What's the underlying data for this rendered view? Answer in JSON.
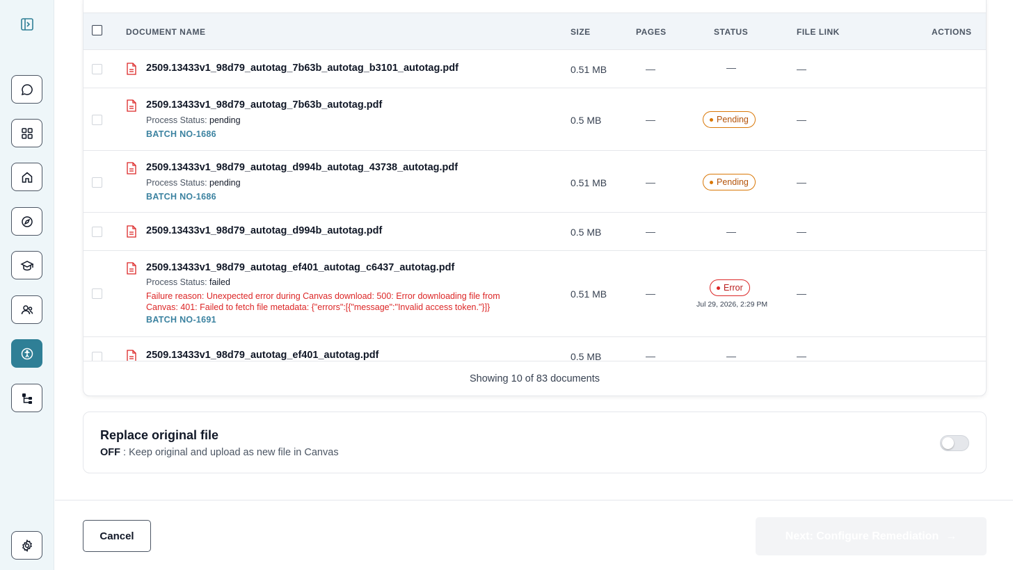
{
  "sidebar": {
    "items": [
      {
        "icon": "chat-bubble-icon"
      },
      {
        "icon": "grid-apps-icon"
      },
      {
        "icon": "home-icon"
      },
      {
        "icon": "compass-icon"
      },
      {
        "icon": "graduation-cap-icon"
      },
      {
        "icon": "users-icon"
      },
      {
        "icon": "accessibility-icon",
        "active": true
      },
      {
        "icon": "hierarchy-icon"
      }
    ],
    "settings_icon": "gear-icon",
    "accent_color": "#2f7f96"
  },
  "table": {
    "headers": {
      "document_name": "DOCUMENT NAME",
      "size": "SIZE",
      "pages": "PAGES",
      "status": "STATUS",
      "file_link": "FILE LINK",
      "actions": "ACTIONS"
    },
    "rows": [
      {
        "name": "2509.13433v1_98d79_autotag_7b63b_autotag_b3101_autotag.pdf",
        "size": "0.51 MB",
        "pages": "—",
        "status": "—",
        "file_link": "—"
      },
      {
        "name": "2509.13433v1_98d79_autotag_7b63b_autotag.pdf",
        "process_label": "Process Status:",
        "process_value": "pending",
        "batch": "BATCH NO-1686",
        "size": "0.5 MB",
        "pages": "—",
        "status": "Pending",
        "file_link": "—"
      },
      {
        "name": "2509.13433v1_98d79_autotag_d994b_autotag_43738_autotag.pdf",
        "process_label": "Process Status:",
        "process_value": "pending",
        "batch": "BATCH NO-1686",
        "size": "0.51 MB",
        "pages": "—",
        "status": "Pending",
        "file_link": "—"
      },
      {
        "name": "2509.13433v1_98d79_autotag_d994b_autotag.pdf",
        "size": "0.5 MB",
        "pages": "—",
        "status": "—",
        "file_link": "—"
      },
      {
        "name": "2509.13433v1_98d79_autotag_ef401_autotag_c6437_autotag.pdf",
        "process_label": "Process Status:",
        "process_value": "failed",
        "failure": "Failure reason: Unexpected error during Canvas download: 500: Error downloading file from Canvas: 401: Failed to fetch file metadata: {\"errors\":[{\"message\":\"Invalid access token.\"}]}",
        "batch": "BATCH NO-1691",
        "size": "0.51 MB",
        "pages": "—",
        "status": "Error",
        "status_time": "Jul 29, 2026, 2:29 PM",
        "file_link": "—"
      },
      {
        "name": "2509.13433v1_98d79_autotag_ef401_autotag.pdf",
        "size": "0.5 MB",
        "pages": "—",
        "status": "—",
        "file_link": "—"
      }
    ],
    "footer": "Showing 10 of 83 documents"
  },
  "replace": {
    "title": "Replace original file",
    "state": "OFF",
    "description": " : Keep original and upload as new file in Canvas",
    "enabled": false
  },
  "actions": {
    "cancel": "Cancel",
    "next": "Next: Configure Remediation",
    "next_arrow": "→"
  }
}
